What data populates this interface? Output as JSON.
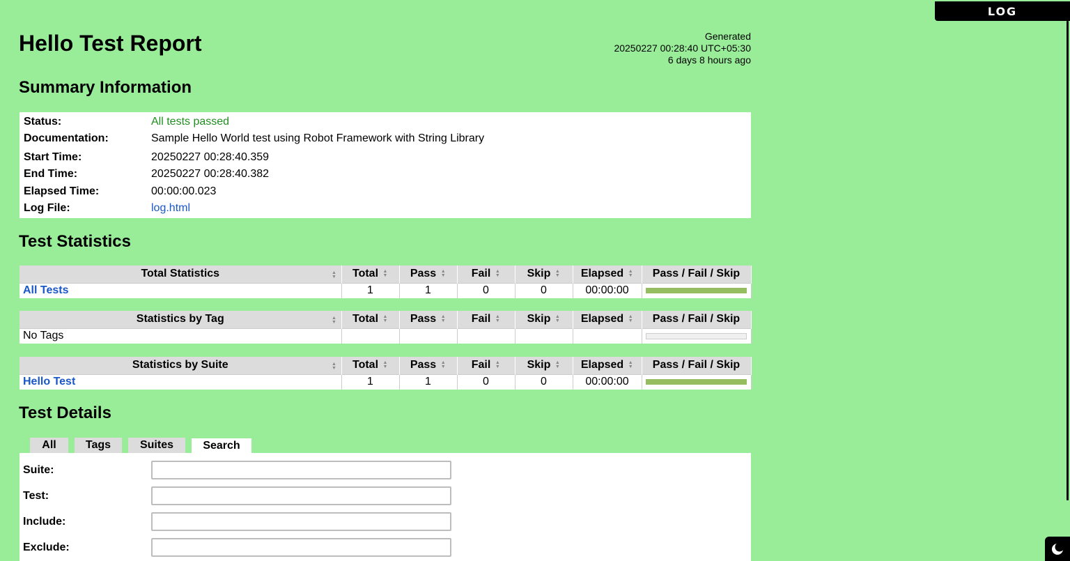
{
  "log_button": {
    "label": "LOG"
  },
  "header": {
    "title": "Hello Test Report",
    "generated_label": "Generated",
    "generated_time": "20250227 00:28:40 UTC+05:30",
    "generated_ago": "6 days 8 hours ago"
  },
  "summary": {
    "heading": "Summary Information",
    "rows": [
      {
        "key": "Status:",
        "value": "All tests passed"
      },
      {
        "key": "Documentation:",
        "value": "Sample Hello World test using Robot Framework with String Library"
      },
      {
        "key": "Start Time:",
        "value": "20250227 00:28:40.359"
      },
      {
        "key": "End Time:",
        "value": "20250227 00:28:40.382"
      },
      {
        "key": "Elapsed Time:",
        "value": "00:00:00.023"
      },
      {
        "key": "Log File:",
        "value": "log.html"
      }
    ]
  },
  "statistics": {
    "heading": "Test Statistics",
    "columns": [
      "Total",
      "Pass",
      "Fail",
      "Skip",
      "Elapsed",
      "Pass / Fail / Skip"
    ],
    "total": {
      "title": "Total Statistics",
      "row": {
        "name": "All Tests",
        "total": "1",
        "pass": "1",
        "fail": "0",
        "skip": "0",
        "elapsed": "00:00:00",
        "pass_ratio": 1.0
      }
    },
    "by_tag": {
      "title": "Statistics by Tag",
      "row": {
        "name": "No Tags",
        "total": "",
        "pass": "",
        "fail": "",
        "skip": "",
        "elapsed": "",
        "pass_ratio": 0
      }
    },
    "by_suite": {
      "title": "Statistics by Suite",
      "row": {
        "name": "Hello Test",
        "total": "1",
        "pass": "1",
        "fail": "0",
        "skip": "0",
        "elapsed": "00:00:00",
        "pass_ratio": 1.0
      }
    }
  },
  "details": {
    "heading": "Test Details",
    "tabs": [
      "All",
      "Tags",
      "Suites",
      "Search"
    ],
    "active_tab": "Search",
    "search_fields": [
      {
        "label": "Suite:",
        "value": ""
      },
      {
        "label": "Test:",
        "value": ""
      },
      {
        "label": "Include:",
        "value": ""
      },
      {
        "label": "Exclude:",
        "value": ""
      }
    ]
  },
  "colors": {
    "background": "#99ed99",
    "pass_bar": "#97bd61",
    "pass_text": "#1f8f1f",
    "link": "#1a57c8"
  },
  "icons": {
    "theme_toggle": "moon-icon",
    "sort": "sort-arrows-icon"
  }
}
